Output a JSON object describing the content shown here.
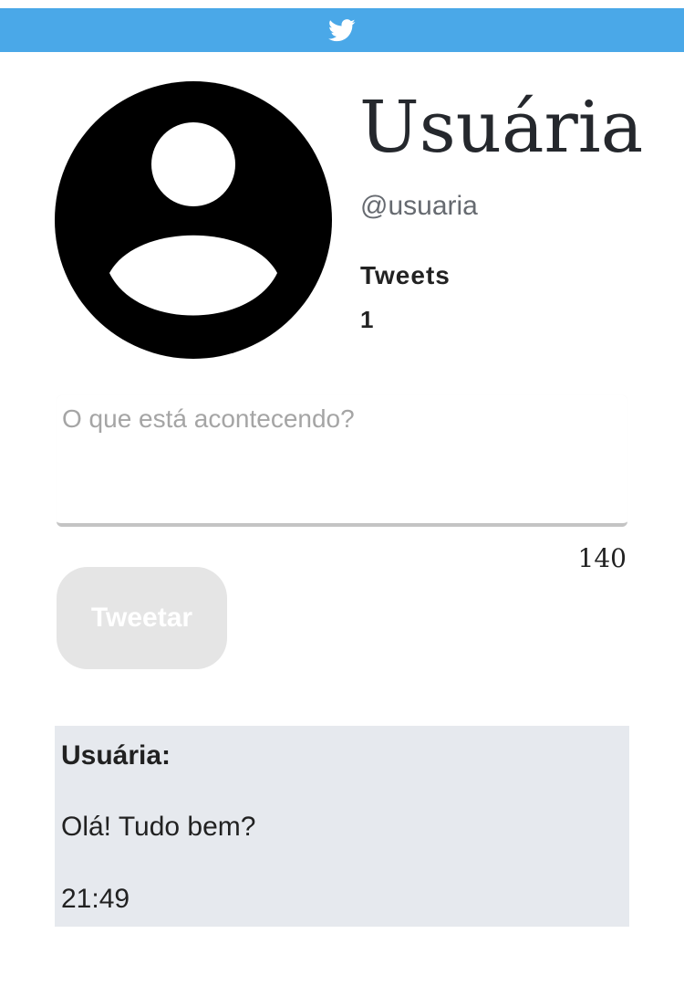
{
  "header": {
    "icon": "twitter-bird-icon",
    "bar_color": "#4AA8E8"
  },
  "profile": {
    "avatar_icon": "user-avatar-icon",
    "name": "Usuária",
    "handle": "@usuaria",
    "tweets_label": "Tweets",
    "tweets_count": "1"
  },
  "composer": {
    "placeholder": "O que está acontecendo?",
    "value": "",
    "remaining_chars": "140",
    "submit_label": "Tweetar"
  },
  "tweets": [
    {
      "author": "Usuária:",
      "text": "Olá! Tudo bem?",
      "time": "21:49"
    }
  ]
}
